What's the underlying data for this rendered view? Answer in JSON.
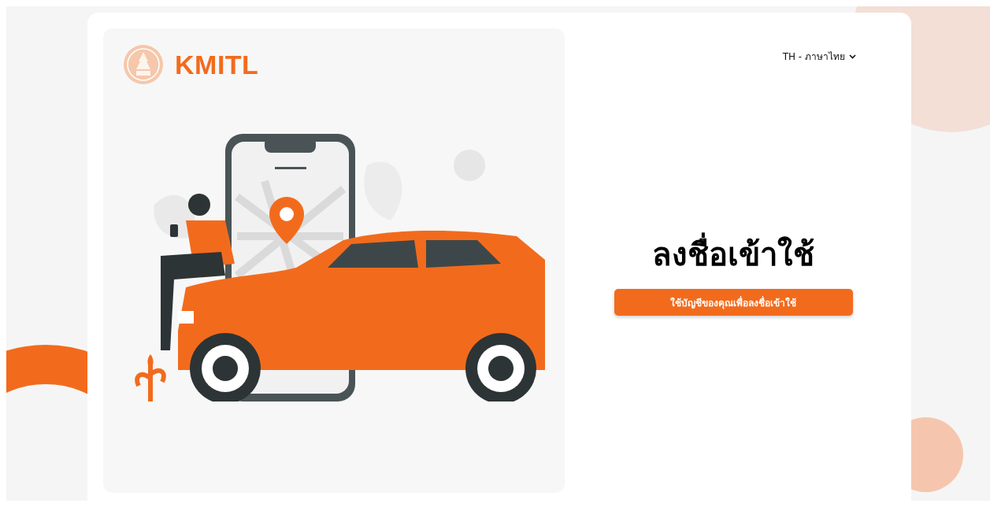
{
  "brand": {
    "name": "KMITL"
  },
  "language_selector": {
    "label": "TH - ภาษาไทย"
  },
  "login": {
    "title": "ลงชื่อเข้าใช้",
    "button": "ใช้บัญชีของคุณเพื่อลงชื่อเข้าใช้"
  }
}
